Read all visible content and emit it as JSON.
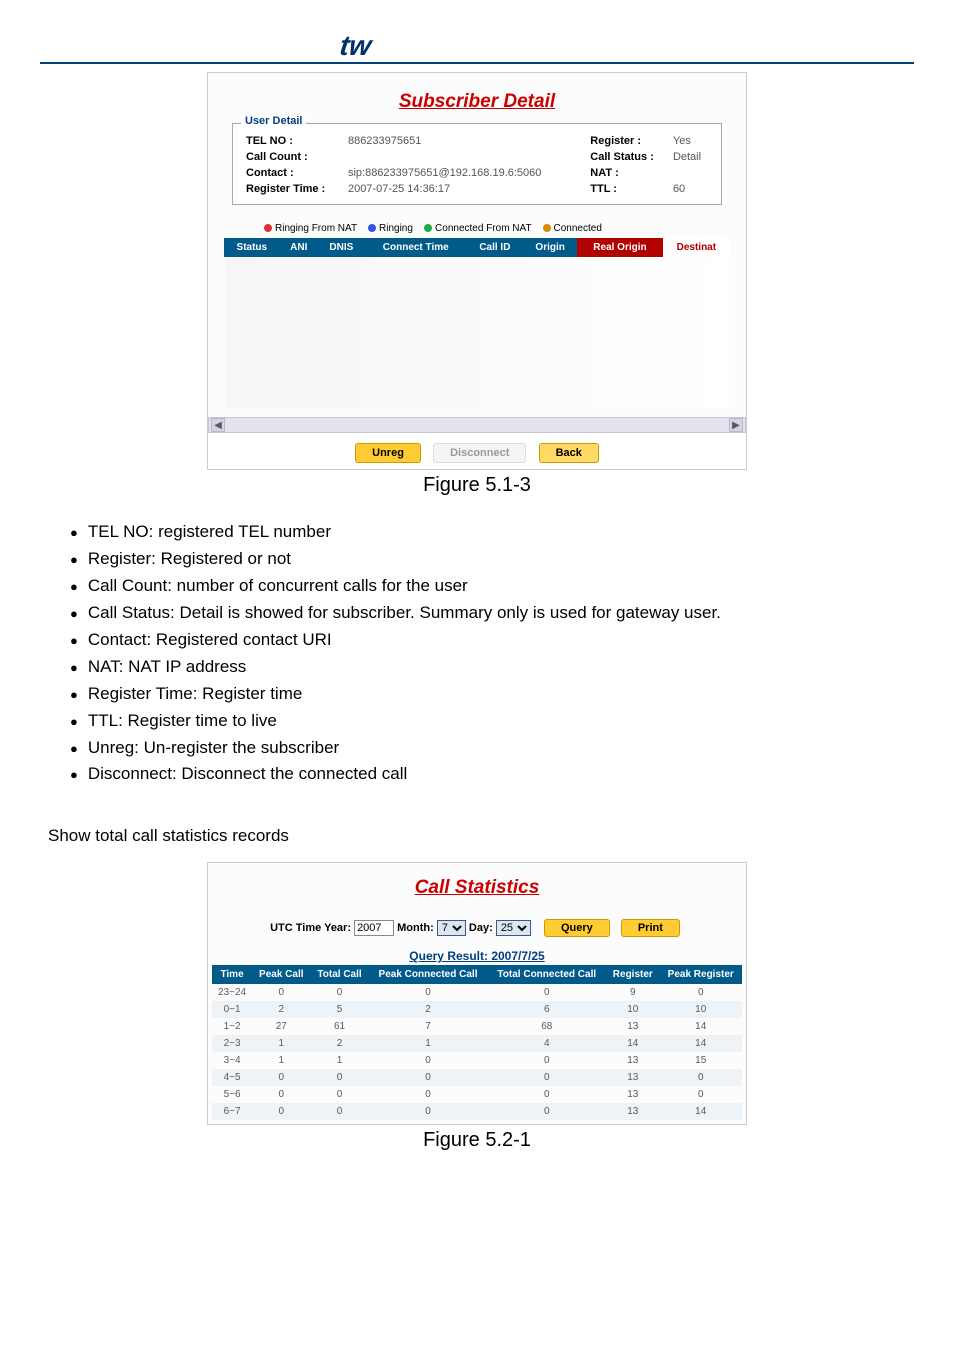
{
  "subscriber_detail": {
    "title": "Subscriber Detail",
    "box_legend": "User Detail",
    "fields": {
      "tel_no_label": "TEL NO :",
      "tel_no": "886233975651",
      "register_label": "Register :",
      "register": "Yes",
      "call_count_label": "Call Count :",
      "call_count": "",
      "call_status_label": "Call Status :",
      "call_status": "Detail",
      "contact_label": "Contact :",
      "contact": "sip:886233975651@192.168.19.6:5060",
      "nat_label": "NAT :",
      "nat": "",
      "reg_time_label": "Register Time :",
      "reg_time": "2007-07-25 14:36:17",
      "ttl_label": "TTL :",
      "ttl": "60"
    },
    "legend": {
      "ring_nat": "Ringing From NAT",
      "ring": "Ringing",
      "conn_nat": "Connected From NAT",
      "conn": "Connected"
    },
    "cols": [
      "Status",
      "ANI",
      "DNIS",
      "Connect Time",
      "Call ID",
      "Origin",
      "Real Origin",
      "Destinat"
    ],
    "buttons": {
      "unreg": "Unreg",
      "disconnect": "Disconnect",
      "back": "Back"
    },
    "figure": "Figure 5.1-3"
  },
  "bullets": [
    "TEL NO: registered TEL number",
    "Register: Registered or not",
    "Call Count: number of concurrent calls for the user",
    "Call Status: Detail is showed for subscriber. Summary only is used for gateway user.",
    "Contact: Registered contact URI",
    "NAT: NAT IP address",
    "Register Time: Register time",
    "TTL: Register time to live",
    "Unreg: Un-register the subscriber",
    "Disconnect: Disconnect the connected call"
  ],
  "section_text": "Show total call statistics records",
  "call_stats": {
    "title": "Call Statistics",
    "utc_label": "UTC Time Year:",
    "year": "2007",
    "month_label": "Month:",
    "month": "7",
    "day_label": "Day:",
    "day": "25",
    "query_btn": "Query",
    "print_btn": "Print",
    "result_label": "Query Result: 2007/7/25",
    "cols": [
      "Time",
      "Peak Call",
      "Total Call",
      "Peak Connected Call",
      "Total Connected Call",
      "Register",
      "Peak Register"
    ],
    "rows": [
      {
        "t": "23~24",
        "pc": "0",
        "tc": "0",
        "pcc": "0",
        "tcc": "0",
        "r": "9",
        "pr": "0"
      },
      {
        "t": "0~1",
        "pc": "2",
        "tc": "5",
        "pcc": "2",
        "tcc": "6",
        "r": "10",
        "pr": "10"
      },
      {
        "t": "1~2",
        "pc": "27",
        "tc": "61",
        "pcc": "7",
        "tcc": "68",
        "r": "13",
        "pr": "14"
      },
      {
        "t": "2~3",
        "pc": "1",
        "tc": "2",
        "pcc": "1",
        "tcc": "4",
        "r": "14",
        "pr": "14"
      },
      {
        "t": "3~4",
        "pc": "1",
        "tc": "1",
        "pcc": "0",
        "tcc": "0",
        "r": "13",
        "pr": "15"
      },
      {
        "t": "4~5",
        "pc": "0",
        "tc": "0",
        "pcc": "0",
        "tcc": "0",
        "r": "13",
        "pr": "0"
      },
      {
        "t": "5~6",
        "pc": "0",
        "tc": "0",
        "pcc": "0",
        "tcc": "0",
        "r": "13",
        "pr": "0"
      },
      {
        "t": "6~7",
        "pc": "0",
        "tc": "0",
        "pcc": "0",
        "tcc": "0",
        "r": "13",
        "pr": "14"
      }
    ],
    "figure": "Figure 5.2-1"
  },
  "chart_data": {
    "type": "table",
    "title": "Call Statistics — Query Result: 2007/7/25",
    "columns": [
      "Time",
      "Peak Call",
      "Total Call",
      "Peak Connected Call",
      "Total Connected Call",
      "Register",
      "Peak Register"
    ],
    "rows": [
      [
        "23~24",
        0,
        0,
        0,
        0,
        9,
        0
      ],
      [
        "0~1",
        2,
        5,
        2,
        6,
        10,
        10
      ],
      [
        "1~2",
        27,
        61,
        7,
        68,
        13,
        14
      ],
      [
        "2~3",
        1,
        2,
        1,
        4,
        14,
        14
      ],
      [
        "3~4",
        1,
        1,
        0,
        0,
        13,
        15
      ],
      [
        "4~5",
        0,
        0,
        0,
        0,
        13,
        0
      ],
      [
        "5~6",
        0,
        0,
        0,
        0,
        13,
        0
      ],
      [
        "6~7",
        0,
        0,
        0,
        0,
        13,
        14
      ]
    ]
  }
}
